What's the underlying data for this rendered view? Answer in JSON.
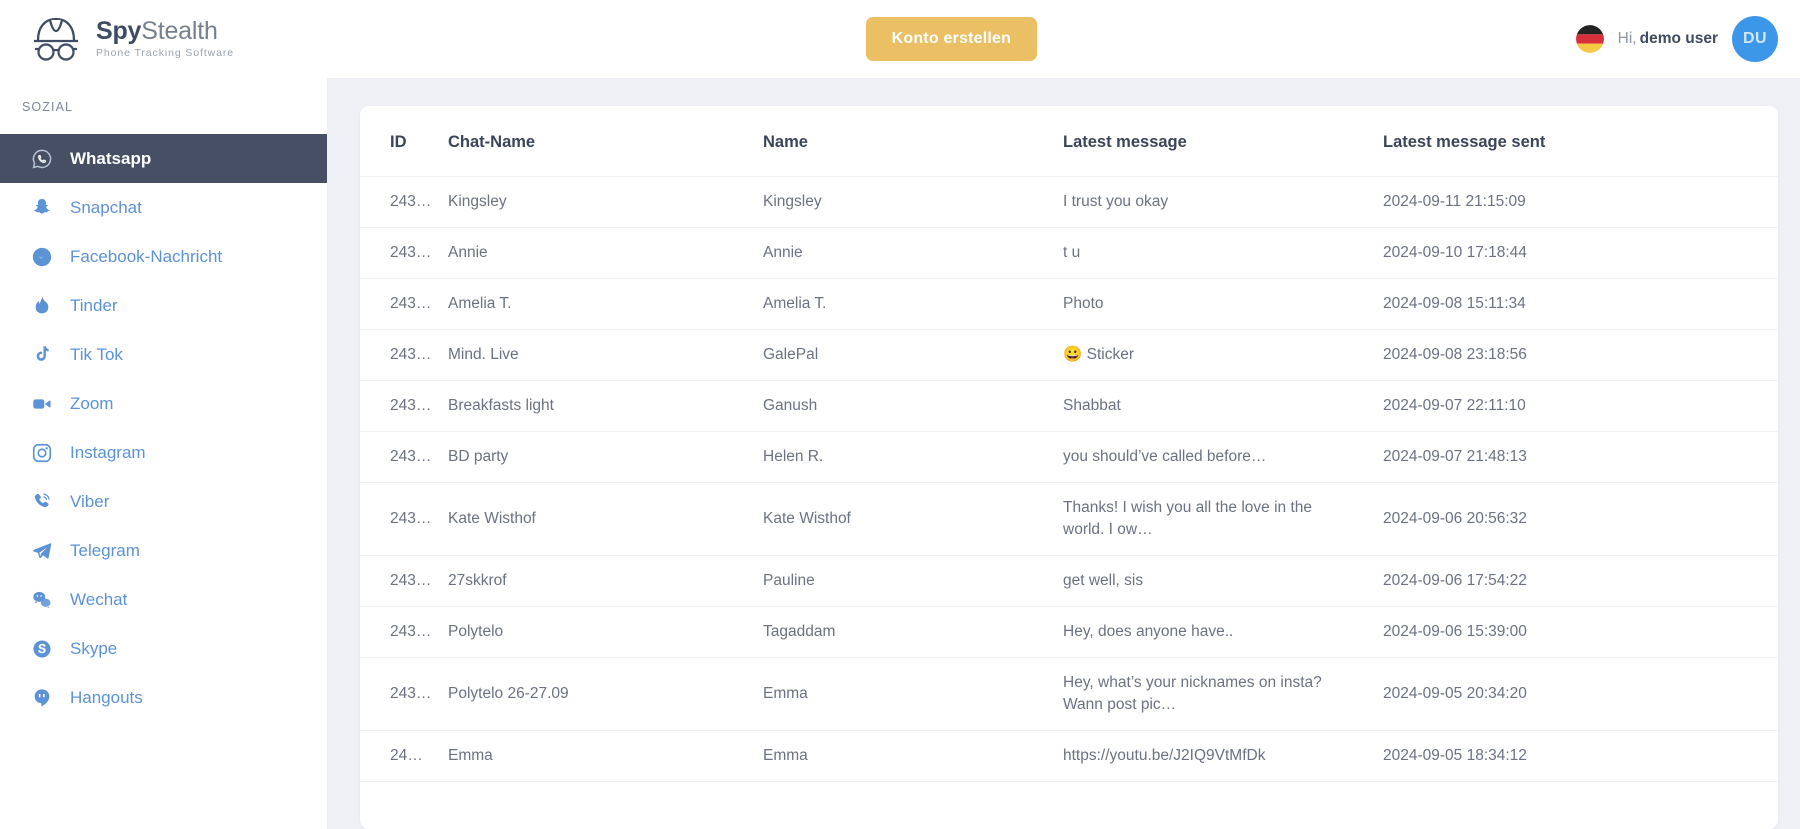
{
  "header": {
    "brand": {
      "name_part1": "Spy",
      "name_part2": "Stealth",
      "tagline": "Phone Tracking Software",
      "logo_icon": "detective-hat-glasses-icon"
    },
    "cta_label": "Konto erstellen",
    "language_flag": "german-flag-icon",
    "greeting_prefix": "Hi,",
    "user_name": "demo user",
    "avatar_initials": "DU"
  },
  "sidebar": {
    "section_title": "SOZIAL",
    "items": [
      {
        "label": "Whatsapp",
        "icon": "whatsapp-icon",
        "active": true
      },
      {
        "label": "Snapchat",
        "icon": "snapchat-icon",
        "active": false
      },
      {
        "label": "Facebook-Nachricht",
        "icon": "facebook-messenger-icon",
        "active": false
      },
      {
        "label": "Tinder",
        "icon": "tinder-flame-icon",
        "active": false
      },
      {
        "label": "Tik Tok",
        "icon": "tiktok-note-icon",
        "active": false
      },
      {
        "label": "Zoom",
        "icon": "zoom-video-camera-icon",
        "active": false
      },
      {
        "label": "Instagram",
        "icon": "instagram-icon",
        "active": false
      },
      {
        "label": "Viber",
        "icon": "viber-phone-icon",
        "active": false
      },
      {
        "label": "Telegram",
        "icon": "telegram-paper-plane-icon",
        "active": false
      },
      {
        "label": "Wechat",
        "icon": "wechat-bubbles-icon",
        "active": false
      },
      {
        "label": "Skype",
        "icon": "skype-icon",
        "active": false
      },
      {
        "label": "Hangouts",
        "icon": "hangouts-icon",
        "active": false
      }
    ]
  },
  "table": {
    "columns": [
      "ID",
      "Chat-Name",
      "Name",
      "Latest message",
      "Latest message sent"
    ],
    "rows": [
      {
        "id": "243…",
        "chat_name": "Kingsley",
        "name": "Kingsley",
        "message": "I trust you okay",
        "sent": "2024-09-11 21:15:09"
      },
      {
        "id": "243…",
        "chat_name": "Annie",
        "name": "Annie",
        "message": "t u",
        "sent": "2024-09-10 17:18:44"
      },
      {
        "id": "243…",
        "chat_name": "Amelia T.",
        "name": "Amelia T.",
        "message": "Photo",
        "sent": "2024-09-08 15:11:34"
      },
      {
        "id": "243…",
        "chat_name": "Mind. Live",
        "name": "GalePal",
        "message": "😀 Sticker",
        "sent": "2024-09-08 23:18:56"
      },
      {
        "id": "243…",
        "chat_name": "Breakfasts light",
        "name": "Ganush",
        "message": "Shabbat",
        "sent": "2024-09-07 22:11:10"
      },
      {
        "id": "243…",
        "chat_name": "BD party",
        "name": "Helen R.",
        "message": "you should’ve called before…",
        "sent": "2024-09-07 21:48:13"
      },
      {
        "id": "243…",
        "chat_name": "Kate Wisthof",
        "name": "Kate Wisthof",
        "message": "Thanks! I wish you all the love in the world. I ow…",
        "sent": "2024-09-06 20:56:32"
      },
      {
        "id": "243…",
        "chat_name": "27skkrof",
        "name": "Pauline",
        "message": "get well, sis",
        "sent": "2024-09-06 17:54:22"
      },
      {
        "id": "243…",
        "chat_name": "Polytelo",
        "name": "Tagaddam",
        "message": "Hey, does anyone have..",
        "sent": "2024-09-06 15:39:00"
      },
      {
        "id": "243…",
        "chat_name": "Polytelo 26-27.09",
        "name": "Emma",
        "message": "Hey, what’s your nicknames on insta? Wann post pic…",
        "sent": "2024-09-05 20:34:20"
      },
      {
        "id": "24…",
        "chat_name": "Emma",
        "name": "Emma",
        "message": "https://youtu.be/J2IQ9VtMfDk",
        "sent": "2024-09-05 18:34:12"
      }
    ]
  },
  "colors": {
    "accent_yellow": "#ebbf63",
    "sidebar_active": "#464f63",
    "link_blue": "#5c92d6",
    "avatar_blue": "#3d97e8",
    "content_bg": "#eef0f6"
  }
}
